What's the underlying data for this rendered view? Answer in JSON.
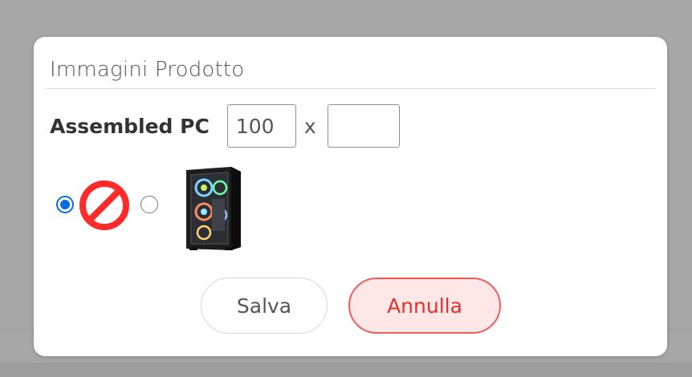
{
  "dialog": {
    "title": "Immagini Prodotto",
    "product_name": "Assembled PC",
    "width_value": "100",
    "times_symbol": "x",
    "height_value": "",
    "image_options": [
      {
        "name": "no-image",
        "selected": true
      },
      {
        "name": "assembled-pc-case",
        "selected": false
      }
    ],
    "save_label": "Salva",
    "cancel_label": "Annulla"
  },
  "colors": {
    "accent_blue": "#0a6cde",
    "cancel_red": "#e0312f",
    "cancel_bg": "#fde7e7",
    "no_image_red": "#ff2a2a"
  },
  "icons": {
    "no_image": "prohibited-circle-icon",
    "product_image": "pc-case-image"
  }
}
